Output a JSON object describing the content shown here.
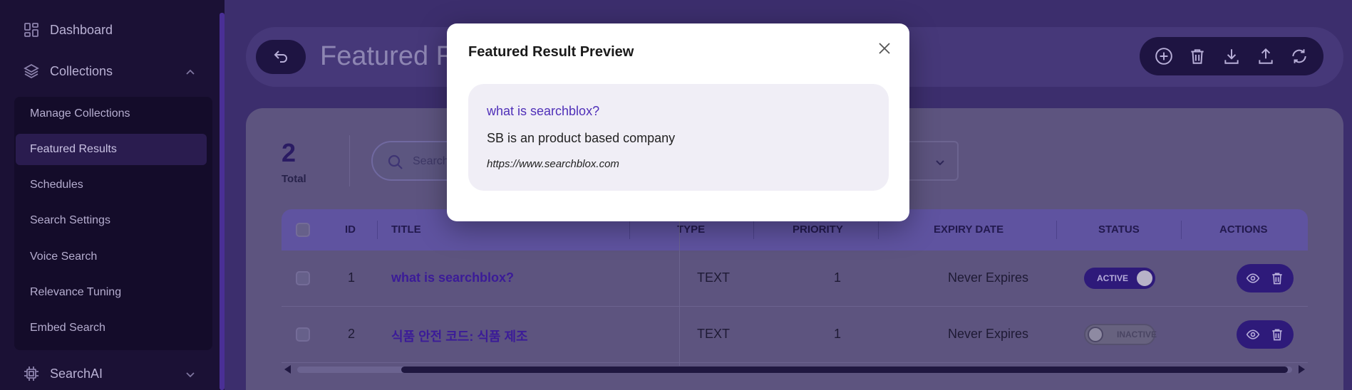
{
  "sidebar": {
    "dashboard": "Dashboard",
    "collections": "Collections",
    "sub_items": [
      "Manage Collections",
      "Featured Results",
      "Schedules",
      "Search Settings",
      "Voice Search",
      "Relevance Tuning",
      "Embed Search"
    ],
    "active_item": "Featured Results",
    "searchai": "SearchAI"
  },
  "header": {
    "page_title": "Featured Results",
    "toolbar_icons": [
      "add-icon",
      "delete-icon",
      "download-icon",
      "upload-icon",
      "refresh-icon"
    ]
  },
  "summary": {
    "total_count": "2",
    "total_label": "Total"
  },
  "search": {
    "placeholder": "Search by"
  },
  "table": {
    "headers": {
      "id": "ID",
      "title": "TITLE",
      "type": "TYPE",
      "priority": "PRIORITY",
      "expiry": "EXPIRY DATE",
      "status": "STATUS",
      "actions": "ACTIONS"
    },
    "rows": [
      {
        "id": "1",
        "title": "what is searchblox?",
        "type": "TEXT",
        "priority": "1",
        "expiry": "Never Expires",
        "status": "ACTIVE"
      },
      {
        "id": "2",
        "title": "식품 안전 코드: 식품 제조",
        "type": "TEXT",
        "priority": "1",
        "expiry": "Never Expires",
        "status": "INACTIVE"
      }
    ]
  },
  "modal": {
    "title": "Featured Result Preview",
    "preview_title": "what is searchblox?",
    "preview_description": "SB is an product based company",
    "preview_url": "https://www.searchblox.com"
  },
  "colors": {
    "sidebar_bg": "#1b1135",
    "accent": "#4f2fb8",
    "modal_bg": "#ffffff",
    "preview_bg": "#f0eef6"
  }
}
